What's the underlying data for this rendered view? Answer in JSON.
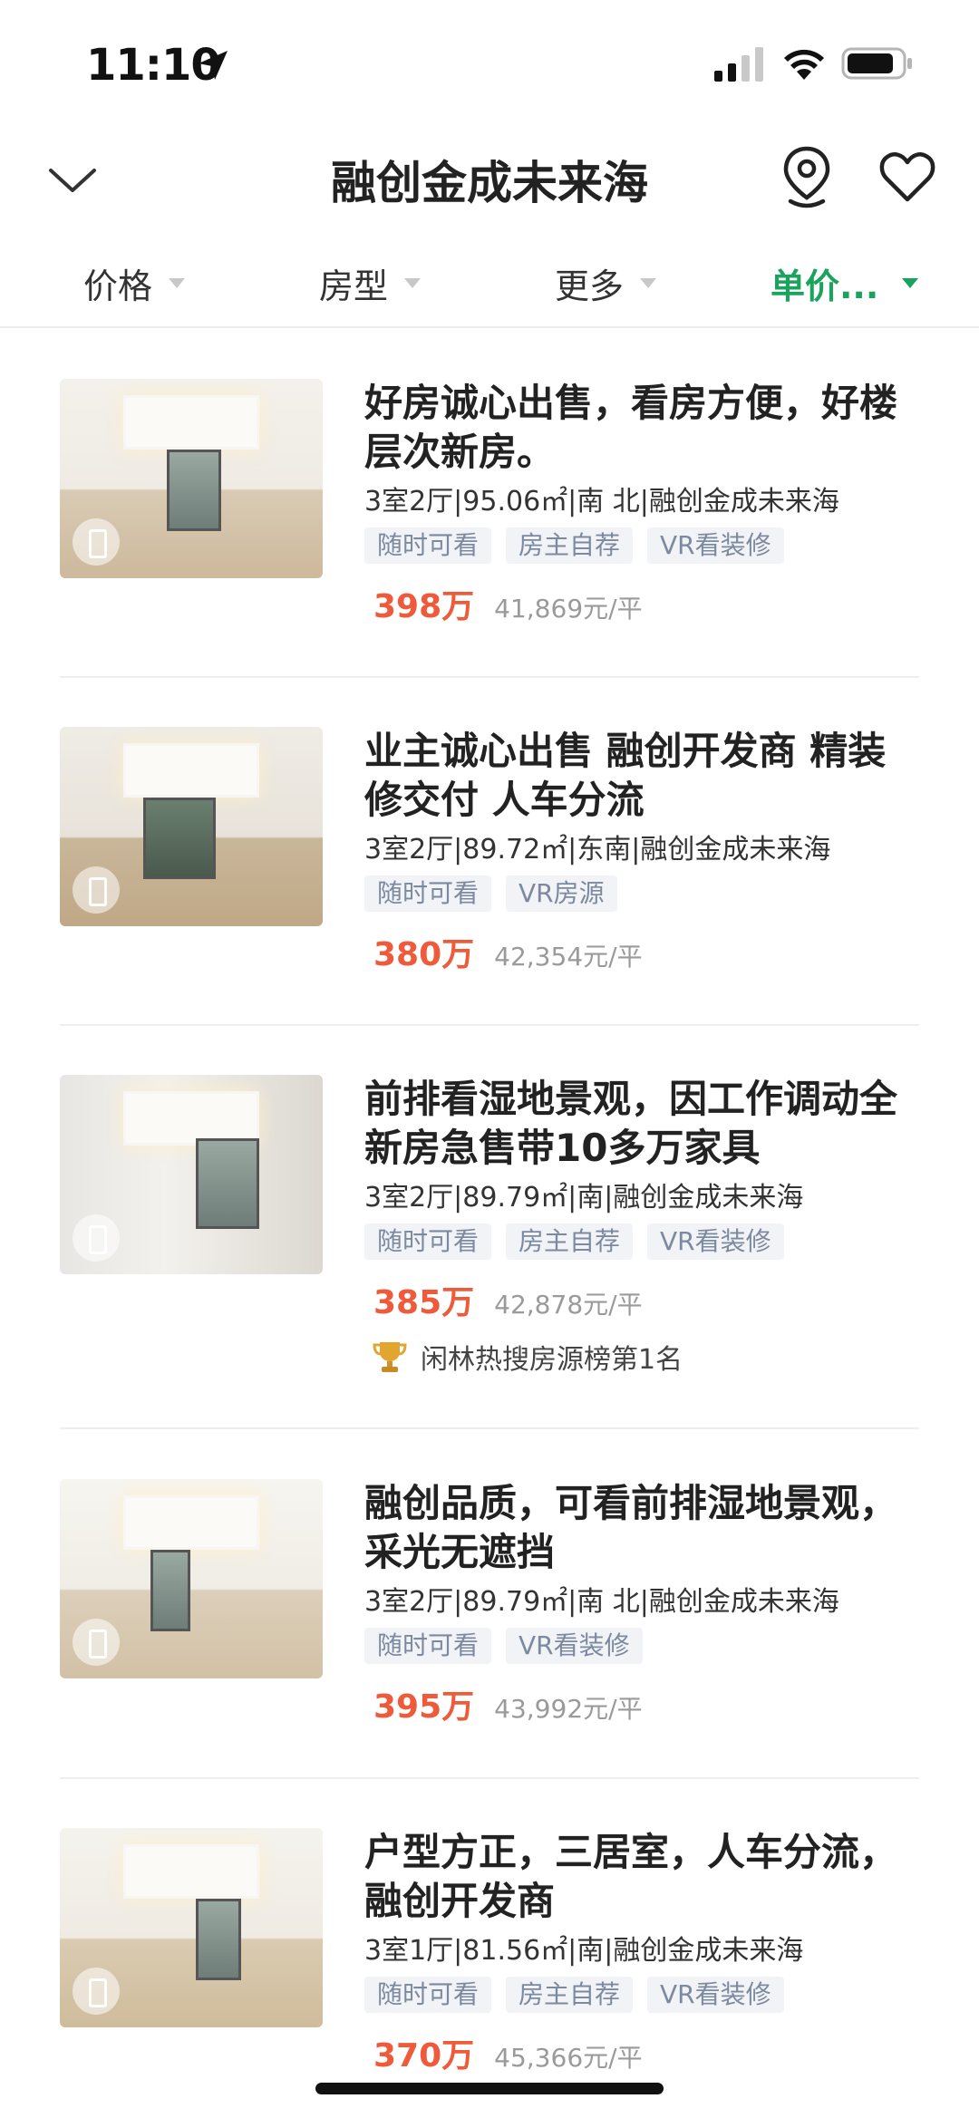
{
  "status_bar": {
    "time": "11:10"
  },
  "nav": {
    "title": "融创金成未来海"
  },
  "filters": [
    {
      "label": "价格",
      "active": false
    },
    {
      "label": "房型",
      "active": false
    },
    {
      "label": "更多",
      "active": false
    },
    {
      "label": "单价...",
      "active": true
    }
  ],
  "colors": {
    "accent_green": "#19a35c",
    "price_red": "#ee5a3a",
    "tag_bg": "#f1f3f6",
    "tag_text": "#7c8aa0"
  },
  "listings": [
    {
      "title": "好房诚心出售，看房方便，好楼层次新房。",
      "meta": "3室2厅|95.06㎡|南 北|融创金成未来海",
      "tags": [
        "随时可看",
        "房主自荐",
        "VR看装修"
      ],
      "price": "398万",
      "unit_price": "41,869元/平"
    },
    {
      "title": "业主诚心出售 融创开发商 精装修交付 人车分流",
      "meta": "3室2厅|89.72㎡|东南|融创金成未来海",
      "tags": [
        "随时可看",
        "VR房源"
      ],
      "price": "380万",
      "unit_price": "42,354元/平"
    },
    {
      "title": "前排看湿地景观，因工作调动全新房急售带10多万家具",
      "meta": "3室2厅|89.79㎡|南|融创金成未来海",
      "tags": [
        "随时可看",
        "房主自荐",
        "VR看装修"
      ],
      "price": "385万",
      "unit_price": "42,878元/平",
      "rank": "闲林热搜房源榜第1名"
    },
    {
      "title": "融创品质，可看前排湿地景观，采光无遮挡",
      "meta": "3室2厅|89.79㎡|南 北|融创金成未来海",
      "tags": [
        "随时可看",
        "VR看装修"
      ],
      "price": "395万",
      "unit_price": "43,992元/平"
    },
    {
      "title": "户型方正，三居室，人车分流，融创开发商",
      "meta": "3室1厅|81.56㎡|南|融创金成未来海",
      "tags": [
        "随时可看",
        "房主自荐",
        "VR看装修"
      ],
      "price": "370万",
      "unit_price": "45,366元/平"
    }
  ]
}
